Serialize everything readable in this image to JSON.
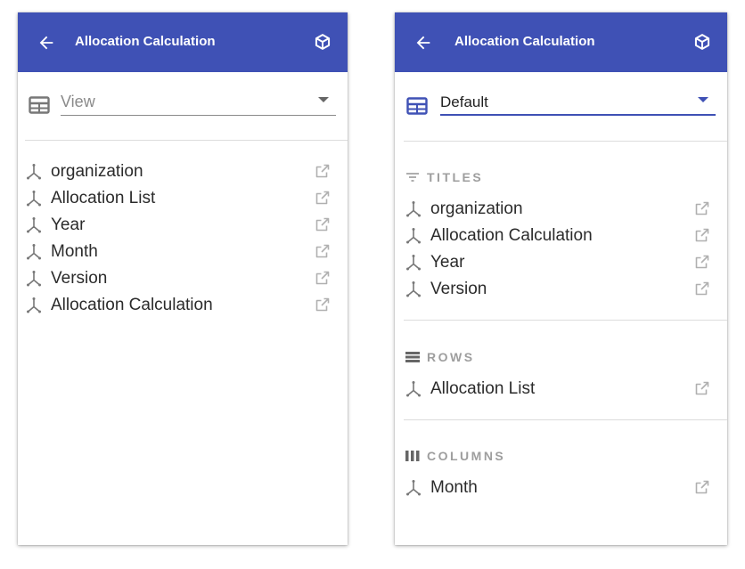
{
  "colors": {
    "header": "#3f51b5",
    "accent": "#3f51b5",
    "icon_grey": "#777777"
  },
  "left_panel": {
    "title": "Allocation Calculation",
    "view_select": {
      "value": "View",
      "is_placeholder": true
    },
    "items": [
      {
        "label": "organization",
        "icon": "axis-icon"
      },
      {
        "label": "Allocation List",
        "icon": "axis-icon"
      },
      {
        "label": "Year",
        "icon": "axis-icon"
      },
      {
        "label": "Month",
        "icon": "axis-icon"
      },
      {
        "label": "Version",
        "icon": "axis-icon"
      },
      {
        "label": "Allocation Calculation",
        "icon": "axis-icon"
      }
    ]
  },
  "right_panel": {
    "title": "Allocation Calculation",
    "view_select": {
      "value": "Default",
      "is_placeholder": false
    },
    "sections": {
      "titles": {
        "label": "TITLES",
        "icon": "filter-lines-icon",
        "items": [
          {
            "label": "organization"
          },
          {
            "label": "Allocation Calculation"
          },
          {
            "label": "Year"
          },
          {
            "label": "Version"
          }
        ]
      },
      "rows": {
        "label": "ROWS",
        "icon": "rows-icon",
        "items": [
          {
            "label": "Allocation List"
          }
        ]
      },
      "columns": {
        "label": "COLUMNS",
        "icon": "columns-icon",
        "items": [
          {
            "label": "Month"
          }
        ]
      }
    }
  }
}
